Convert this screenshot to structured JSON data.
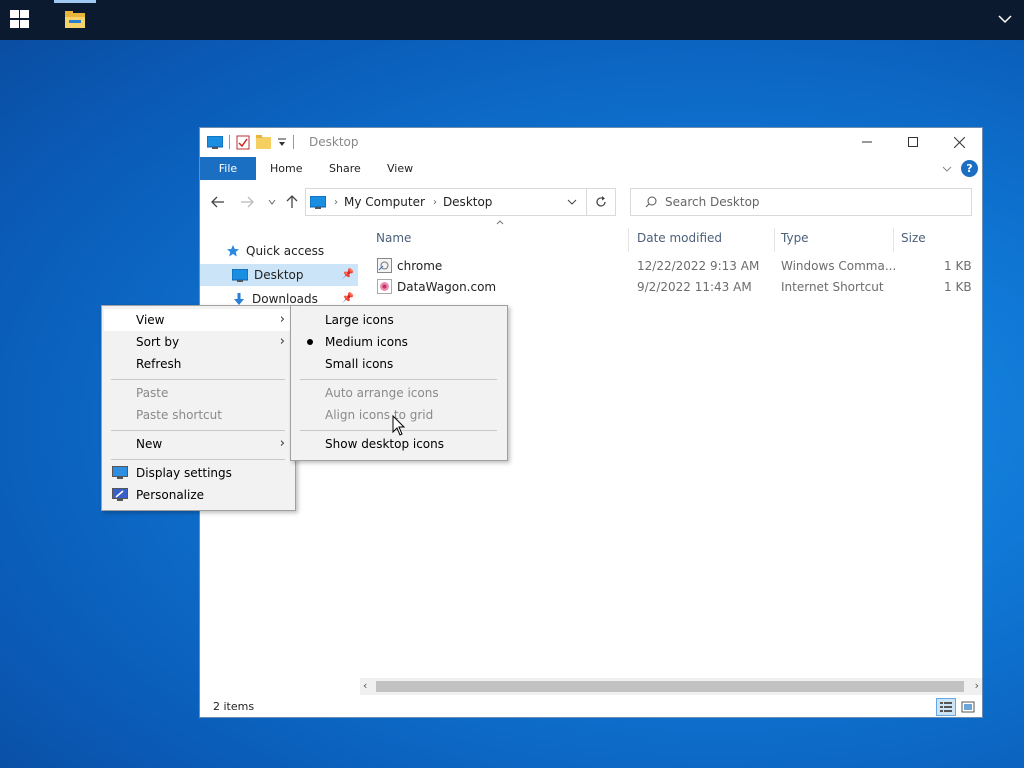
{
  "taskbar": {
    "start_icon": "windows-logo-icon",
    "pinned": [
      {
        "icon": "file-explorer-icon",
        "active": true
      }
    ],
    "tray_icon": "chevron-down-icon"
  },
  "window": {
    "title": "Desktop",
    "ribbon_tabs": [
      "File",
      "Home",
      "Share",
      "View"
    ],
    "address": {
      "segments": [
        "My Computer",
        "Desktop"
      ]
    },
    "search_placeholder": "Search Desktop",
    "nav_pane": [
      {
        "label": "Quick access",
        "icon": "star-icon"
      },
      {
        "label": "Desktop",
        "icon": "desktop-icon",
        "selected": true,
        "pinned": true
      },
      {
        "label": "Downloads",
        "icon": "download-icon",
        "pinned": true
      }
    ],
    "columns": [
      "Name",
      "Date modified",
      "Type",
      "Size"
    ],
    "files": [
      {
        "name": "chrome",
        "date": "12/22/2022 9:13 AM",
        "type": "Windows Comma...",
        "size": "1 KB",
        "icon": "shortcut-icon"
      },
      {
        "name": "DataWagon.com",
        "date": "9/2/2022 11:43 AM",
        "type": "Internet Shortcut",
        "size": "1 KB",
        "icon": "url-shortcut-icon"
      }
    ],
    "status": "2 items"
  },
  "context_menu": {
    "items": [
      "View",
      "Sort by",
      "Refresh",
      "Paste",
      "Paste shortcut",
      "New",
      "Display settings",
      "Personalize"
    ]
  },
  "view_submenu": {
    "items": [
      "Large icons",
      "Medium icons",
      "Small icons",
      "Auto arrange icons",
      "Align icons to grid",
      "Show desktop icons"
    ],
    "selected": "Medium icons"
  },
  "colors": {
    "accent": "#1a6fc2",
    "desktop": "#1078d6",
    "taskbar": "#0b1a2e",
    "selection": "#cce4f7"
  }
}
